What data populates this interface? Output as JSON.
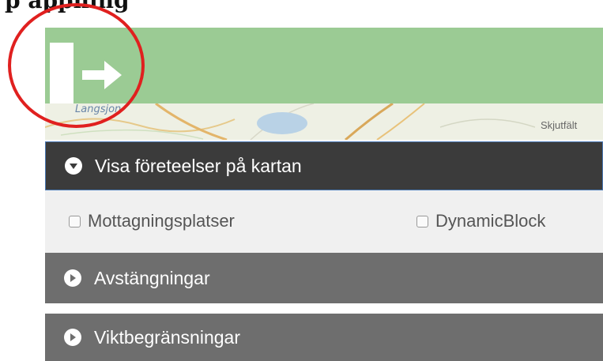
{
  "top_caption": "p appning",
  "header": {
    "color": "#9bcb94",
    "toggle_icon": "arrow-right-icon"
  },
  "map": {
    "label_left": "Langsjon",
    "label_right": "Skjutfält"
  },
  "sections": [
    {
      "label": "Visa företeelser på kartan",
      "state": "expanded",
      "icon": "chevron-down-circle-icon"
    },
    {
      "label": "Avstängningar",
      "state": "collapsed",
      "icon": "chevron-right-circle-icon"
    },
    {
      "label": "Viktbegränsningar",
      "state": "collapsed",
      "icon": "chevron-right-circle-icon"
    }
  ],
  "layers": [
    {
      "label": "Mottagningsplatser",
      "checked": false
    },
    {
      "label": "DynamicBlock",
      "checked": false
    }
  ],
  "highlight": {
    "color": "#e0201f"
  }
}
